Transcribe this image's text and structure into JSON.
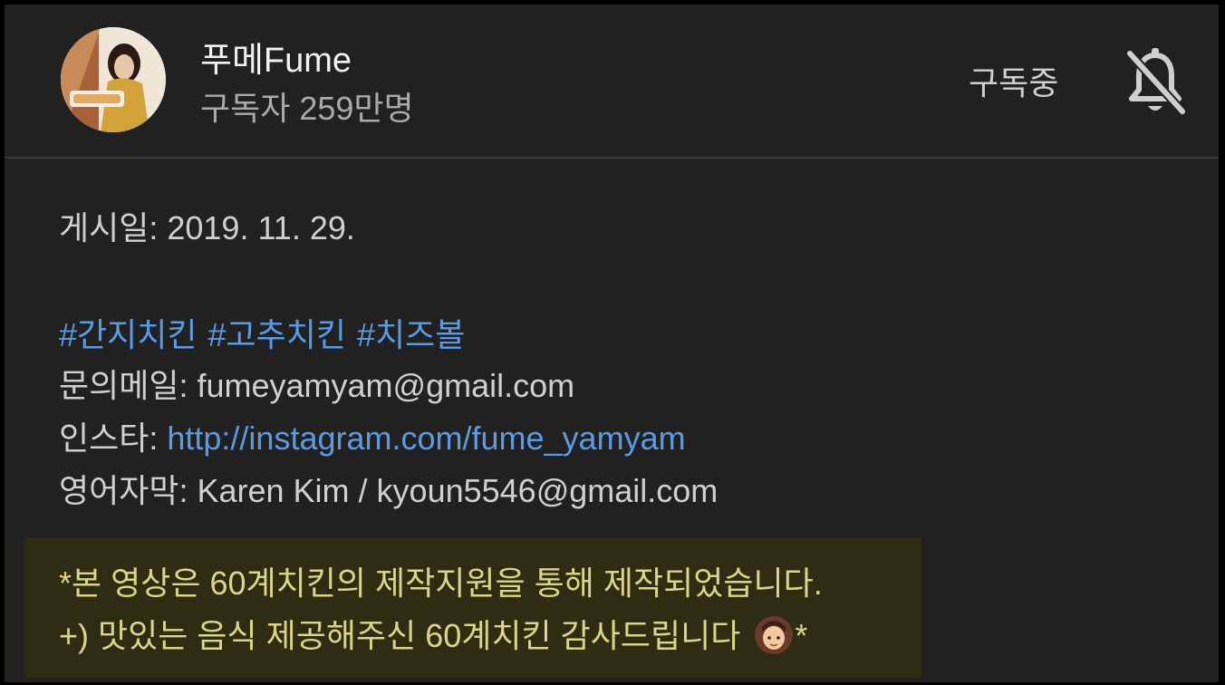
{
  "channel": {
    "name": "푸메Fume",
    "subscribers": "구독자 259만명",
    "subscribed_label": "구독중",
    "bell_icon": "bell-off-icon"
  },
  "description": {
    "published": "게시일: 2019. 11. 29.",
    "hashtags": [
      "#간지치킨",
      "#고추치킨",
      "#치즈볼"
    ],
    "inquiry": "문의메일: fumeyamyam@gmail.com",
    "instagram_prefix": "인스타: ",
    "instagram_link": "http://instagram.com/fume_yamyam",
    "subtitle": "영어자막: Karen Kim / kyoun5546@gmail.com"
  },
  "notice": {
    "line1": "*본 영상은 60계치킨의 제작지원을 통해 제작되었습니다.",
    "line2": "+) 맛있는 음식 제공해주신 60계치킨 감사드립니다",
    "line2_suffix": "*",
    "emoji_icon": "person-emoji-icon"
  },
  "colors": {
    "background": "#212121",
    "link": "#5b9be6",
    "notice_bg": "#2e2d14",
    "notice_text": "#dcd48a"
  }
}
